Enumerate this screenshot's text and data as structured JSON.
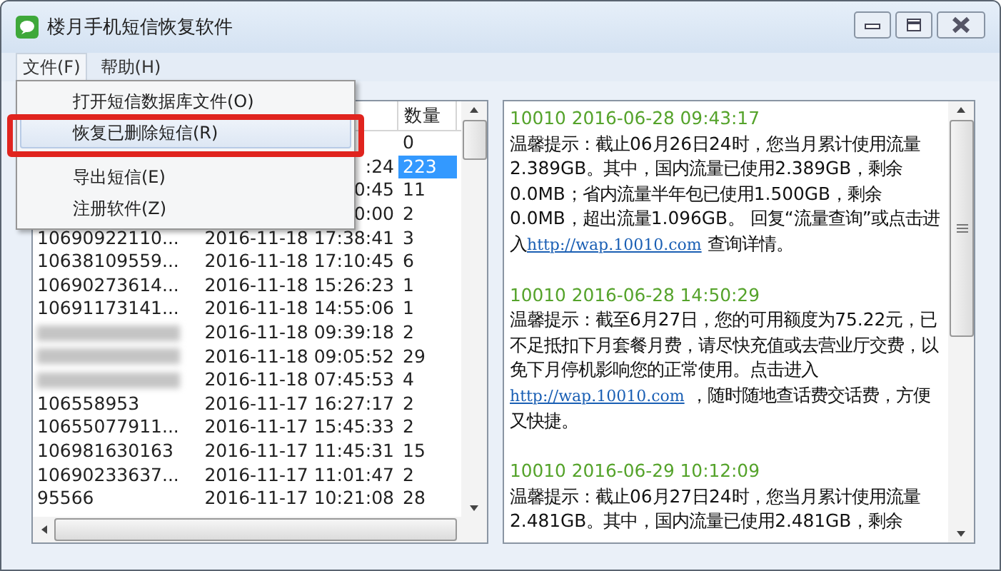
{
  "window": {
    "title": "楼月手机短信恢复软件"
  },
  "menubar": [
    {
      "label": "文件(F)",
      "open": true
    },
    {
      "label": "帮助(H)",
      "open": false
    }
  ],
  "file_menu": [
    {
      "kind": "item",
      "label": "打开短信数据库文件(O)",
      "selected": false
    },
    {
      "kind": "item",
      "label": "恢复已删除短信(R)",
      "selected": true
    },
    {
      "kind": "separator"
    },
    {
      "kind": "item",
      "label": "导出短信(E)",
      "selected": false
    },
    {
      "kind": "item",
      "label": "注册软件(Z)",
      "selected": false
    }
  ],
  "table": {
    "count_header": "数量",
    "rows": [
      {
        "kind": "normal",
        "count": "0",
        "selected": false
      },
      {
        "kind": "normal",
        "time": ":24",
        "count": "223",
        "selected": true
      },
      {
        "kind": "normal",
        "time": "0:45",
        "count": "11",
        "selected": false
      },
      {
        "kind": "normal",
        "time": "0:00",
        "count": "2",
        "selected": false
      },
      {
        "kind": "normal",
        "number": "10690922110...",
        "time": "2016-11-18 17:38:41",
        "count": "3",
        "selected": false
      },
      {
        "kind": "normal",
        "number": "10638109559...",
        "time": "2016-11-18 17:10:45",
        "count": "6",
        "selected": false
      },
      {
        "kind": "normal",
        "number": "10690273614...",
        "time": "2016-11-18 15:26:23",
        "count": "1",
        "selected": false
      },
      {
        "kind": "normal",
        "number": "10691173141...",
        "time": "2016-11-18 14:55:06",
        "count": "1",
        "selected": false
      },
      {
        "kind": "redacted",
        "time": "2016-11-18 09:39:18",
        "count": "2",
        "selected": false
      },
      {
        "kind": "redacted",
        "time": "2016-11-18 09:05:52",
        "count": "29",
        "selected": false
      },
      {
        "kind": "redacted",
        "time": "2016-11-18 07:45:53",
        "count": "4",
        "selected": false
      },
      {
        "kind": "normal",
        "number": "106558953",
        "time": "2016-11-17 16:27:17",
        "count": "2",
        "selected": false
      },
      {
        "kind": "normal",
        "number": "10655077911...",
        "time": "2016-11-17 15:45:33",
        "count": "2",
        "selected": false
      },
      {
        "kind": "normal",
        "number": "106981630163",
        "time": "2016-11-17 11:45:31",
        "count": "15",
        "selected": false
      },
      {
        "kind": "normal",
        "number": "10690233637...",
        "time": "2016-11-17 11:01:47",
        "count": "2",
        "selected": false
      },
      {
        "kind": "normal",
        "number": "95566",
        "time": "2016-11-17 10:21:08",
        "count": "28",
        "selected": false
      }
    ]
  },
  "messages": [
    {
      "header": "10010 2016-06-28 09:43:17",
      "text": "温馨提示：截止06月26日24时，您当月累计使用流量2.389GB。其中，国内流量已使用2.389GB，剩余0.0MB；省内流量半年包已使用1.500GB，剩余0.0MB，超出流量1.096GB。 回复“流量查询”或点击进入",
      "link": "http://wap.10010.com",
      "text_after": " 查询详情。"
    },
    {
      "header": "10010 2016-06-28 14:50:29",
      "text": "温馨提示：截至6月27日，您的可用额度为75.22元，已不足抵扣下月套餐月费，请尽快充值或去营业厅交费，以免下月停机影响您的正常使用。点击进入 ",
      "link": "http://wap.10010.com",
      "text_after": " ，随时随地查话费交话费，方便又快捷。"
    },
    {
      "header": "10010 2016-06-29 10:12:09",
      "text": "温馨提示：截止06月27日24时，您当月累计使用流量2.481GB。其中，国内流量已使用2.481GB，剩余"
    }
  ]
}
